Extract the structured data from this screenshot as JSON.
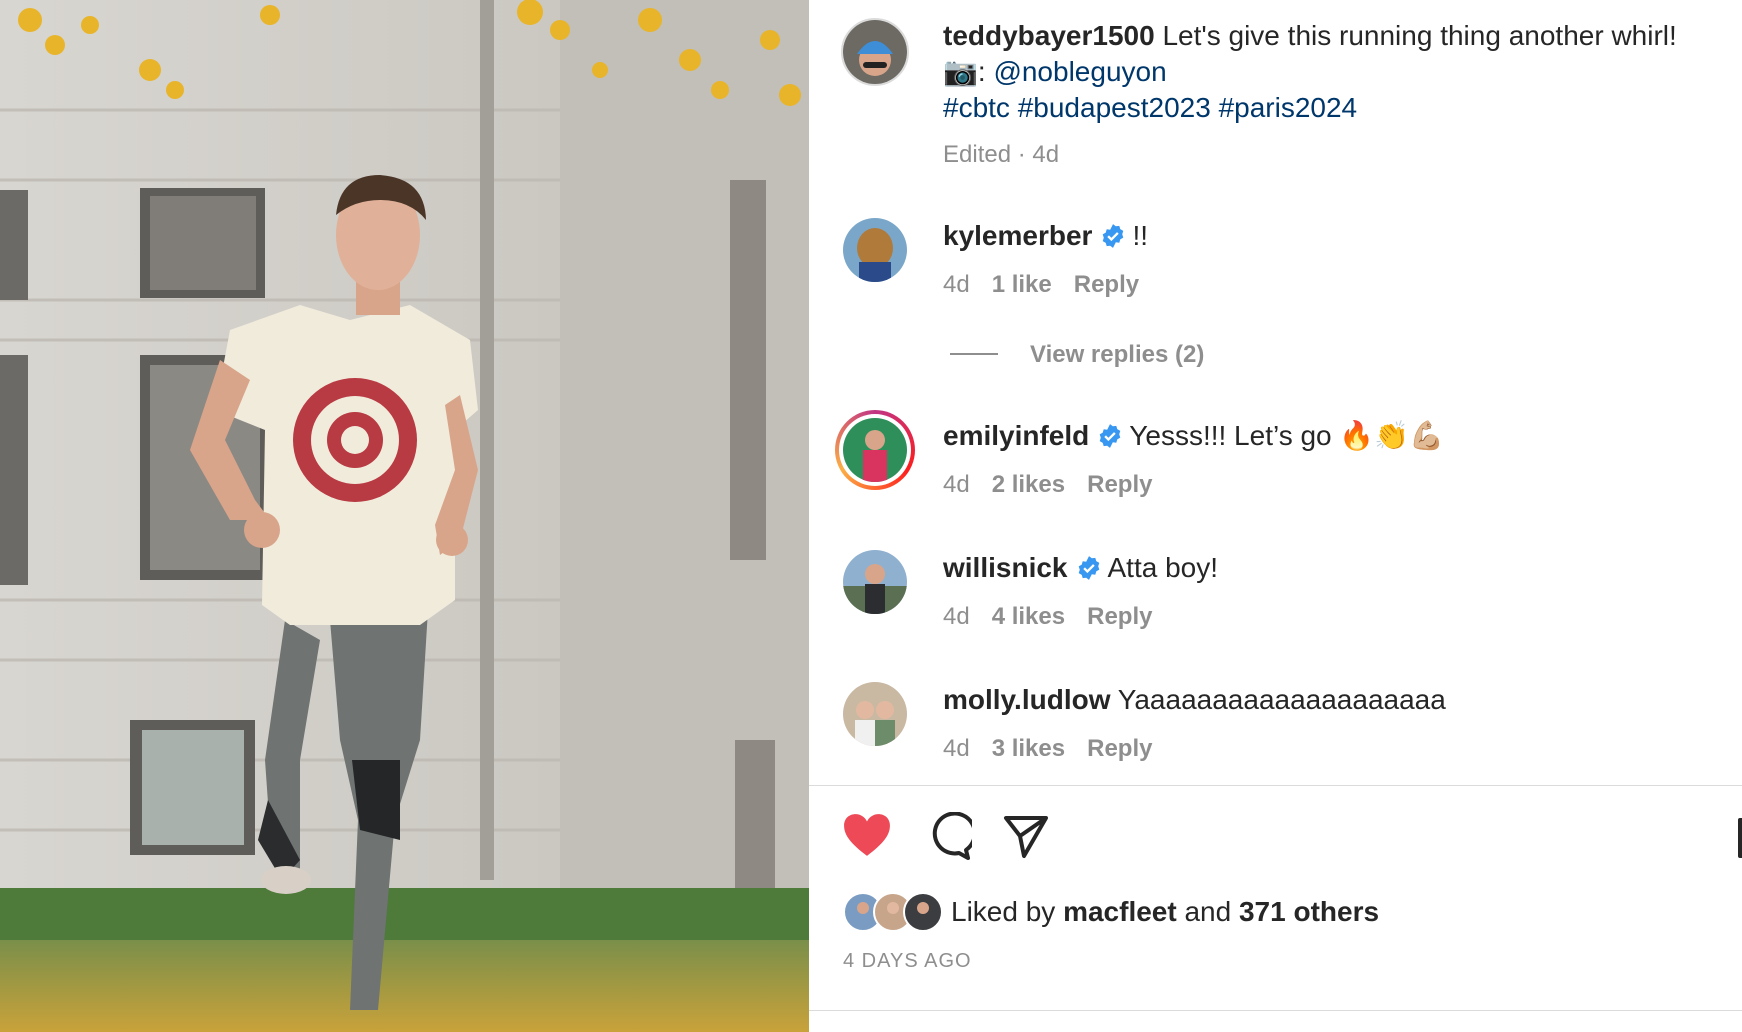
{
  "post": {
    "author": "teddybayer1500",
    "caption": "Let's give this running thing another whirl!",
    "photo_credit_emoji": "📷:",
    "photo_credit_handle": "@nobleguyon",
    "hashtags": [
      "#cbtc",
      "#budapest2023",
      "#paris2024"
    ],
    "meta": "Edited · 4d"
  },
  "comments": [
    {
      "username": "kylemerber",
      "verified": true,
      "text": "!!",
      "age": "4d",
      "likes": "1 like",
      "reply": "Reply"
    },
    {
      "username": "emilyinfeld",
      "verified": true,
      "text": "Yesss!!! Let’s go 🔥👏💪🏼",
      "age": "4d",
      "likes": "2 likes",
      "reply": "Reply"
    },
    {
      "username": "willisnick",
      "verified": true,
      "text": "Atta boy!",
      "age": "4d",
      "likes": "4 likes",
      "reply": "Reply"
    },
    {
      "username": "molly.ludlow",
      "verified": false,
      "text": "Yaaaaaaaaaaaaaaaaaaaa",
      "age": "4d",
      "likes": "3 likes",
      "reply": "Reply"
    }
  ],
  "view_replies": "View replies (2)",
  "actions": {
    "like_icon": "heart-filled-icon",
    "comment_icon": "comment-icon",
    "share_icon": "paper-plane-icon",
    "save_icon": "bookmark-icon"
  },
  "likes": {
    "prefix": "Liked by",
    "user": "macfleet",
    "joiner": "and",
    "others": "371 others"
  },
  "timestamp": "4 DAYS AGO",
  "colors": {
    "heart": "#ed4956",
    "verified": "#3897f0",
    "link": "#00376b",
    "secondary_text": "#8e8e8e"
  }
}
